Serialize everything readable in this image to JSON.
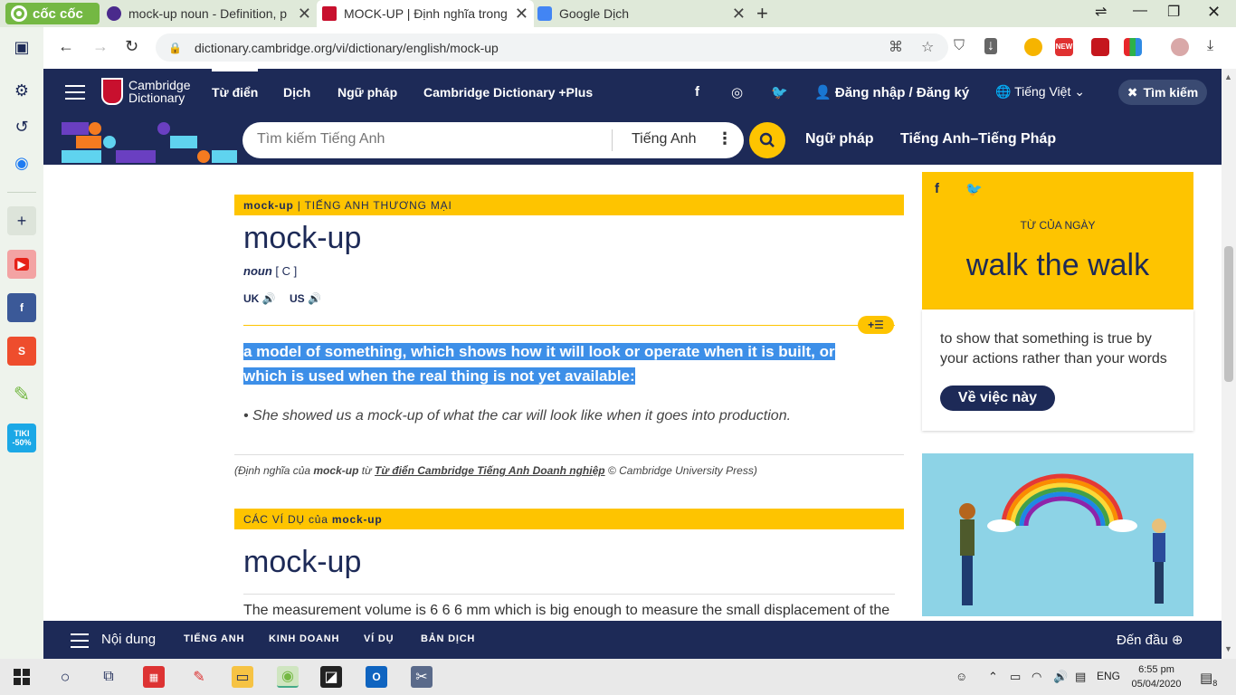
{
  "browser": {
    "brand": "cốc cốc",
    "tabs": [
      {
        "title": "mock-up noun - Definition, p",
        "active": false
      },
      {
        "title": "MOCK-UP | Định nghĩa trong",
        "active": true
      },
      {
        "title": "Google Dịch",
        "active": false
      }
    ],
    "url": "dictionary.cambridge.org/vi/dictionary/english/mock-up",
    "ext_new_badge": "NEW"
  },
  "leftbar": {
    "tiki_label": "TIKI -50%",
    "shopee_label": "S"
  },
  "header": {
    "logo_line1": "Cambridge",
    "logo_line2": "Dictionary",
    "nav": [
      "Từ điển",
      "Dịch",
      "Ngữ pháp",
      "Cambridge Dictionary +Plus"
    ],
    "login": "Đăng nhập / Đăng ký",
    "language": "Tiếng Việt",
    "search_button": "Tìm kiếm"
  },
  "search": {
    "placeholder": "Tìm kiếm Tiếng Anh",
    "lang": "Tiếng Anh",
    "links": [
      "Ngữ pháp",
      "Tiếng Anh–Tiếng Pháp"
    ]
  },
  "entry": {
    "section_word": "mock-up",
    "section_tag": " | TIẾNG ANH THƯƠNG MẠI",
    "headword": "mock-up",
    "pos": "noun",
    "grammar": " [ C ]",
    "uk": "UK",
    "us": "US",
    "definition": "a model of something, which shows how it will look or operate when it is built, or which is used when the real thing is not yet available:",
    "example": "• She showed us a mock-up of what the car will look like when it goes into production.",
    "credit_pre": "(Định nghĩa của ",
    "credit_word": "mock-up",
    "credit_mid": " từ ",
    "credit_link": "Từ điển Cambridge Tiếng Anh Doanh nghiệp",
    "credit_post": " © Cambridge University Press)"
  },
  "examples": {
    "section_pre": "CÁC VÍ DỤ của ",
    "section_word": "mock-up",
    "headword": "mock-up",
    "first": "The measurement volume is 6 6 6 mm which is big enough to measure the small displacement of the"
  },
  "wotd": {
    "label": "TỪ CỦA NGÀY",
    "word": "walk the walk",
    "gloss": "to show that something is true by your actions rather than your words",
    "button": "Về việc này"
  },
  "bottombar": {
    "menu": "Nội dung",
    "links": [
      "TIẾNG ANH",
      "KINH DOANH",
      "VÍ DỤ",
      "BẢN DỊCH"
    ],
    "top": "Đến đầu"
  },
  "taskbar": {
    "lang": "ENG",
    "time": "6:55 pm",
    "date": "05/04/2020",
    "notif": "8"
  },
  "colors": {
    "navy": "#1d2a57",
    "yellow": "#fec400",
    "highlight": "#3d8fe8"
  }
}
